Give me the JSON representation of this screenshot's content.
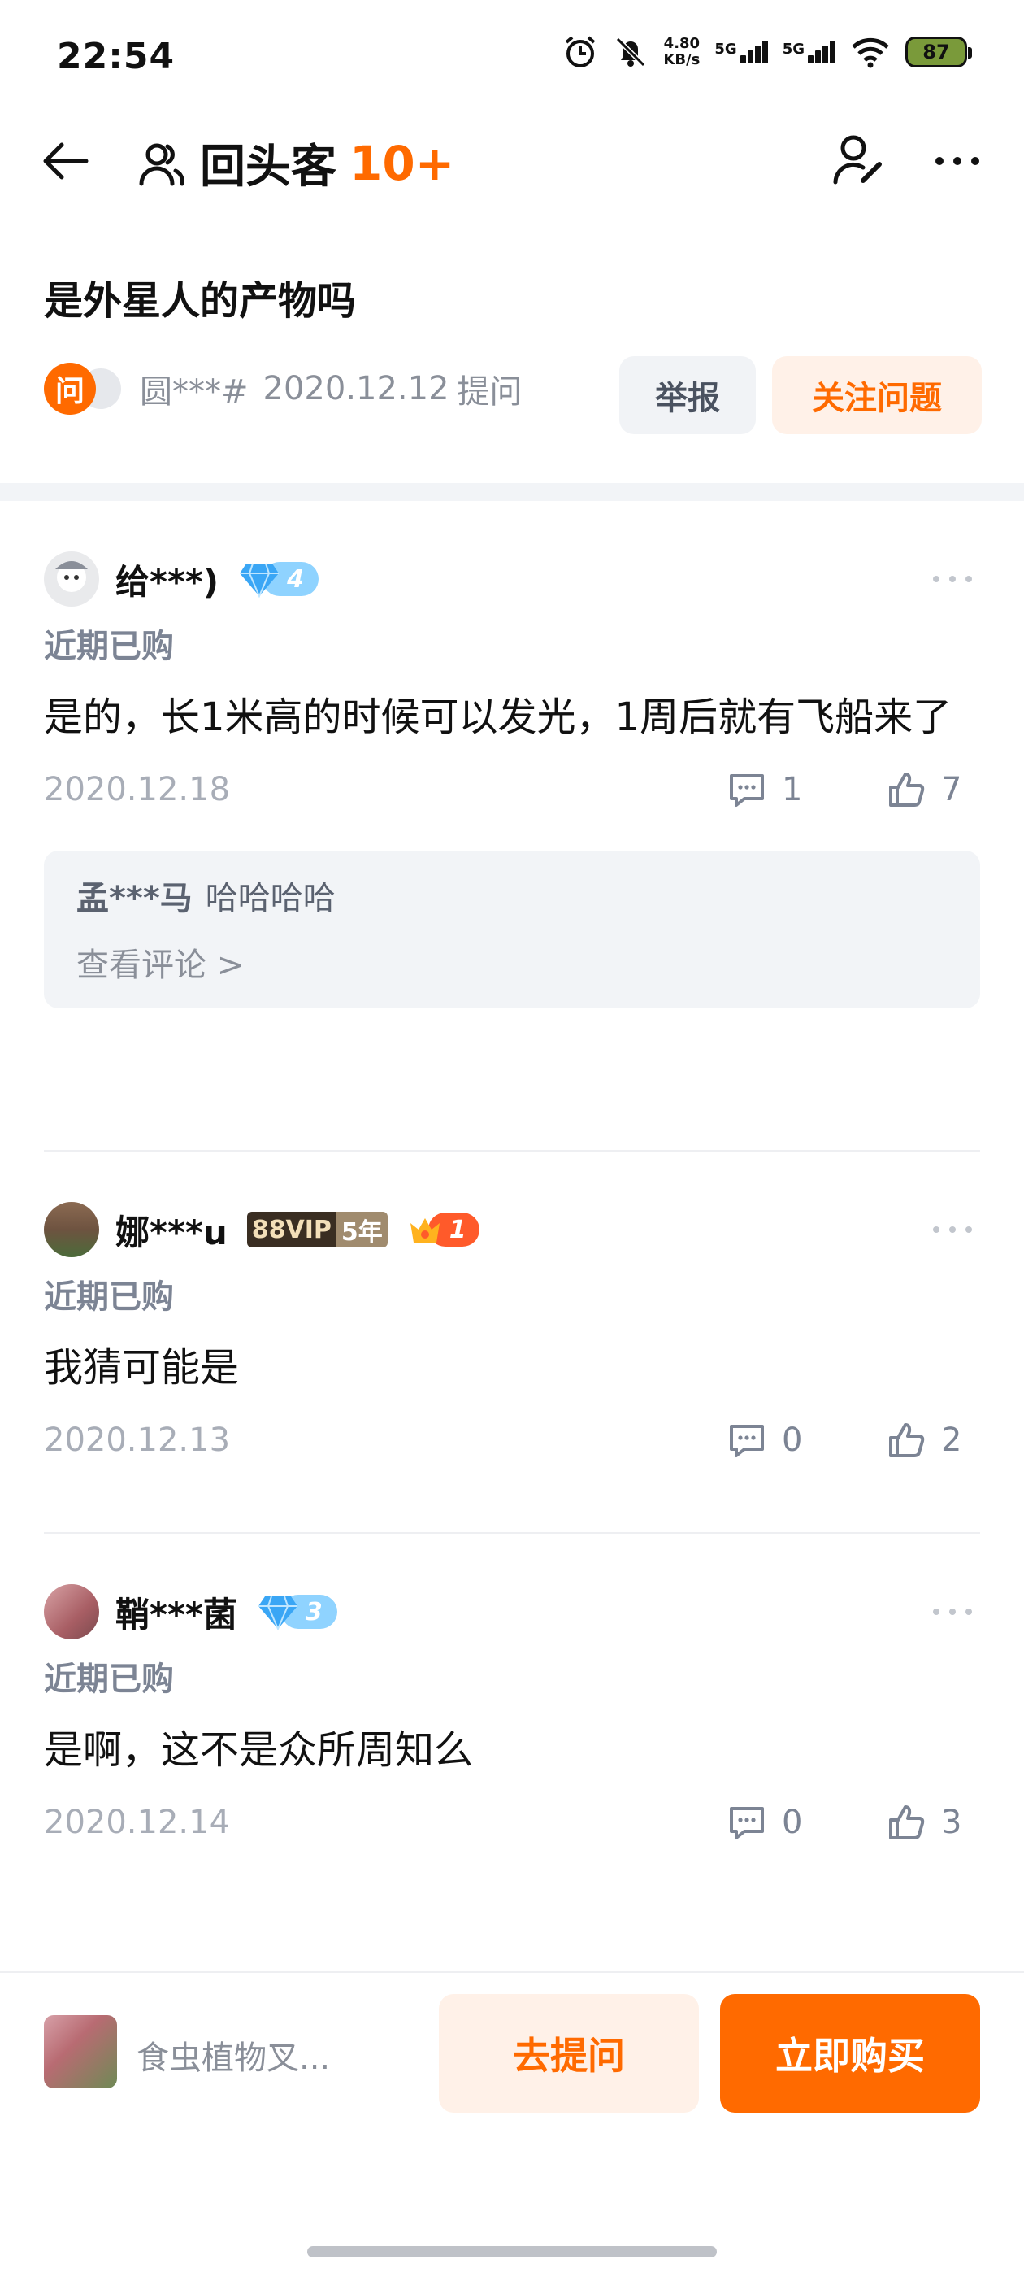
{
  "status_bar": {
    "time": "22:54",
    "speed_value": "4.80",
    "speed_unit": "KB/s",
    "net1": "5G",
    "net2": "5G",
    "battery": "87",
    "icons": [
      "alarm-icon",
      "mute-bell-icon",
      "wifi-icon",
      "battery-icon"
    ]
  },
  "nav": {
    "title": "回头客",
    "count": "10+",
    "icons": [
      "back-arrow-icon",
      "people-icon",
      "user-edit-icon",
      "more-dots-icon"
    ]
  },
  "question": {
    "title": "是外星人的产物吗",
    "badge": "问",
    "asker": "圆***#",
    "date": "2020.12.12",
    "ask_suffix": "提问",
    "report_label": "举报",
    "follow_label": "关注问题"
  },
  "answers": [
    {
      "name": "给***)",
      "level": "4",
      "recent_label": "近期已购",
      "text": "是的，长1米高的时候可以发光，1周后就有飞船来了",
      "date": "2020.12.18",
      "comments": "1",
      "likes": "7",
      "reply": {
        "author": "孟***马",
        "text": "哈哈哈哈",
        "view_label": "查看评论 >"
      }
    },
    {
      "name": "娜***u",
      "vip_left": "88VIP",
      "vip_right": "5年",
      "crown_level": "1",
      "recent_label": "近期已购",
      "text": "我猜可能是",
      "date": "2020.12.13",
      "comments": "0",
      "likes": "2"
    },
    {
      "name": "鞘***菌",
      "level": "3",
      "recent_label": "近期已购",
      "text": "是啊，这不是众所周知么",
      "date": "2020.12.14",
      "comments": "0",
      "likes": "3"
    }
  ],
  "bottom": {
    "product_name": "食虫植物叉...",
    "ask_label": "去提问",
    "buy_label": "立即购买"
  },
  "colors": {
    "accent": "#ff6a00",
    "accent_soft": "#fff1e8",
    "muted_text": "#8a8f99",
    "panel_bg": "#f2f4f7"
  }
}
